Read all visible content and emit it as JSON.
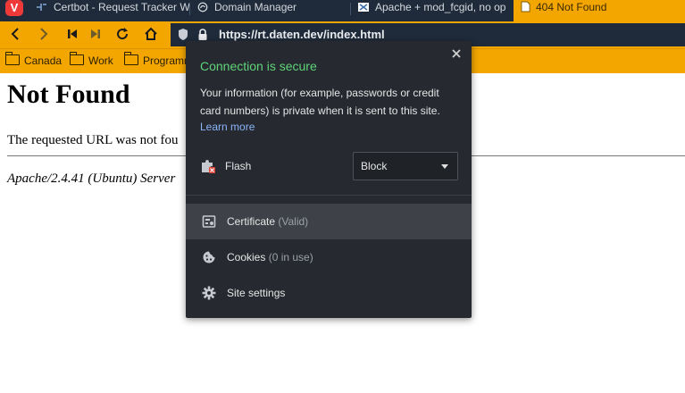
{
  "tabs": [
    {
      "title": "Certbot - Request Tracker W",
      "icon": "rt-favicon-icon",
      "active": false
    },
    {
      "title": "Domain Manager",
      "icon": "domain-manager-favicon-icon",
      "active": false
    },
    {
      "title": "Apache + mod_fcgid, no op",
      "icon": "apache-favicon-icon",
      "active": false
    },
    {
      "title": "404 Not Found",
      "icon": "page-icon",
      "active": true
    }
  ],
  "address_bar": {
    "url": "https://rt.daten.dev/index.html"
  },
  "bookmarks": [
    {
      "label": "Canada",
      "icon": "folder-icon"
    },
    {
      "label": "Work",
      "icon": "folder-icon"
    },
    {
      "label": "Programm",
      "icon": "folder-icon"
    }
  ],
  "page": {
    "heading": "Not Found",
    "message": "The requested URL was not fou",
    "server": "Apache/2.4.41 (Ubuntu) Server"
  },
  "popup": {
    "title": "Connection is secure",
    "description": "Your information (for example, passwords or credit card numbers) is private when it is sent to this site.",
    "learn_more": "Learn more",
    "flash": {
      "label": "Flash",
      "value": "Block"
    },
    "certificate": {
      "label": "Certificate",
      "note": "(Valid)"
    },
    "cookies": {
      "label": "Cookies",
      "note": "(0 in use)"
    },
    "site_settings": {
      "label": "Site settings"
    }
  },
  "colors": {
    "accent": "#f3a600",
    "tab_strip": "#1f2b3a",
    "secure_green": "#5fd478",
    "link_blue": "#8ab4f8",
    "popup_bg": "#262a30"
  }
}
